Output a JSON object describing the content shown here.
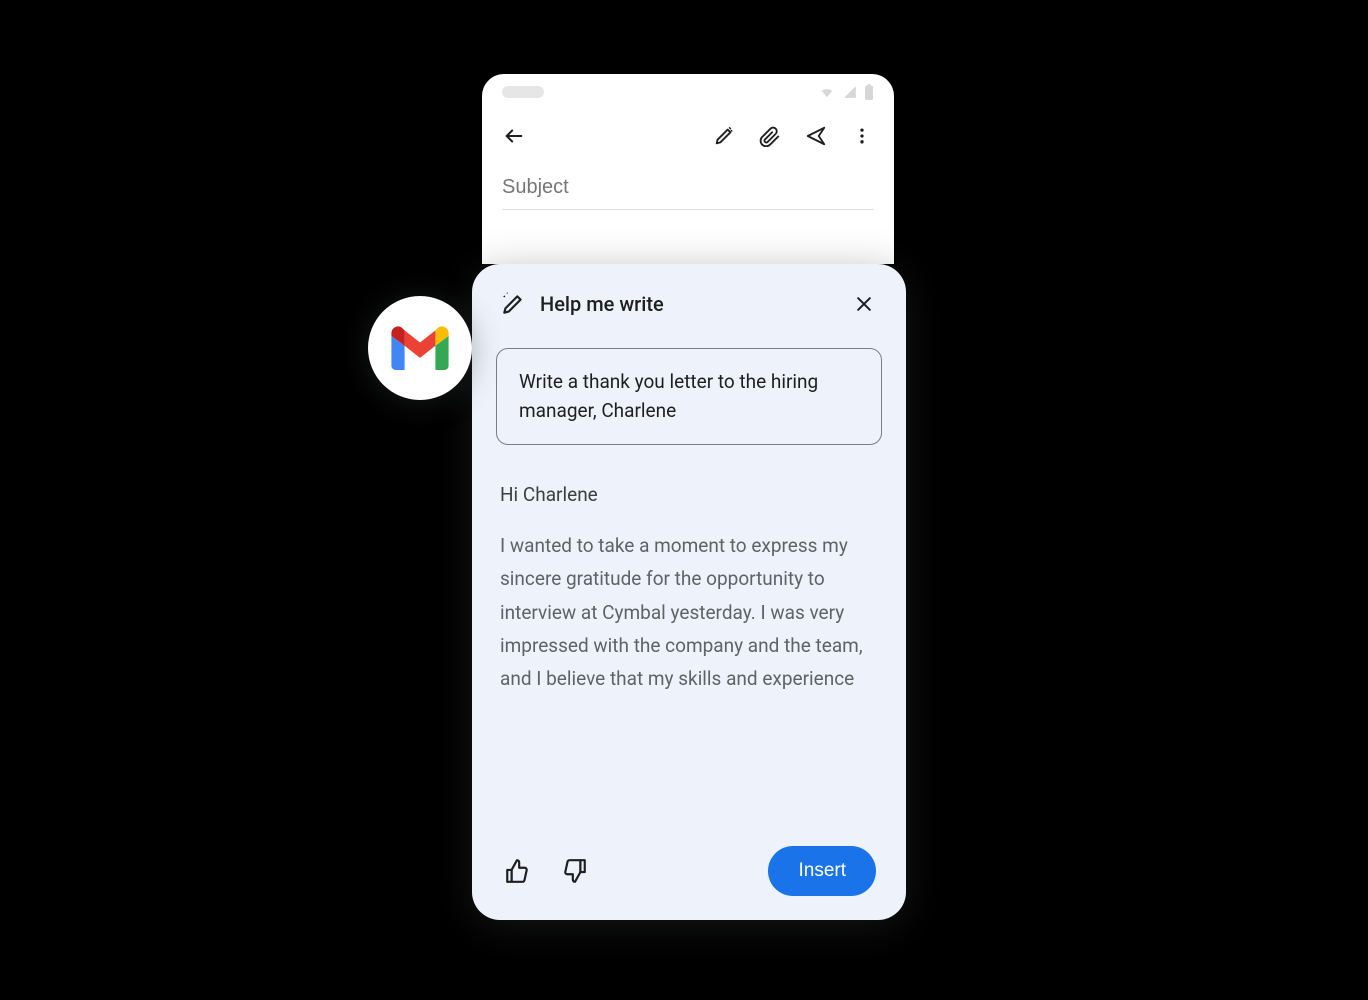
{
  "compose": {
    "subject_placeholder": "Subject",
    "subject_value": ""
  },
  "hmw": {
    "title": "Help me write",
    "prompt": "Write a thank you letter to the hiring manager, Charlene",
    "greeting": "Hi Charlene",
    "body": "I wanted to take a moment to express my sincere gratitude for the opportunity to interview at Cymbal yesterday. I was very impressed with the company and the team, and I believe that my skills and experience",
    "insert_label": "Insert"
  },
  "icons": {
    "back": "back-arrow-icon",
    "magic_pencil": "magic-pencil-icon",
    "attachment": "attachment-icon",
    "send": "send-icon",
    "more": "more-vert-icon",
    "close": "close-icon",
    "thumbs_up": "thumbs-up-icon",
    "thumbs_down": "thumbs-down-icon",
    "wifi": "wifi-icon",
    "signal": "signal-icon",
    "battery": "battery-icon",
    "gmail": "gmail-icon"
  },
  "colors": {
    "card_bg": "#eef3fb",
    "primary": "#1a73e8",
    "text": "#1f1f1f",
    "muted": "#5f6368"
  }
}
